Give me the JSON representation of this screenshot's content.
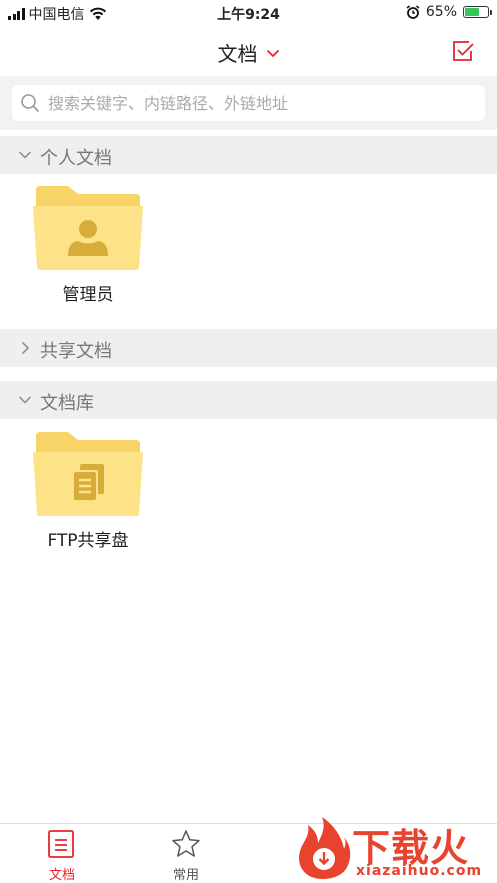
{
  "status_bar": {
    "carrier": "中国电信",
    "time": "上午9:24",
    "battery_percent": "65%",
    "battery_level": 0.65
  },
  "nav": {
    "title": "文档",
    "title_icon": "chevron-down-icon",
    "action_icon": "edit-check-icon"
  },
  "search": {
    "placeholder": "搜索关键字、内链路径、外链地址"
  },
  "sections": {
    "personal": {
      "label": "个人文档",
      "expanded": true,
      "items": [
        {
          "label": "管理员",
          "icon": "user-folder-icon"
        }
      ]
    },
    "shared": {
      "label": "共享文档",
      "expanded": false
    },
    "library": {
      "label": "文档库",
      "expanded": true,
      "items": [
        {
          "label": "FTP共享盘",
          "icon": "docs-folder-icon"
        }
      ]
    }
  },
  "tabs": [
    {
      "label": "文档",
      "icon": "document-icon",
      "active": true
    },
    {
      "label": "常用",
      "icon": "star-icon",
      "active": false
    }
  ],
  "watermark": {
    "brand": "下载火",
    "site": "xiazaihuo.com"
  },
  "colors": {
    "accent": "#e3262c",
    "folder": "#fde287",
    "folder_tab": "#f8d468",
    "folder_glyph": "#d8ac3a"
  }
}
